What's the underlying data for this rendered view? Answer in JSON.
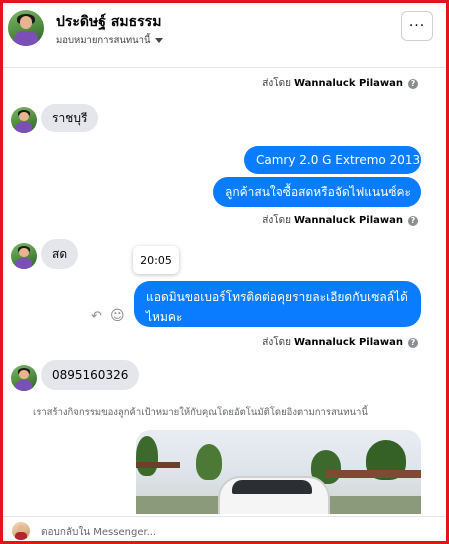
{
  "header": {
    "name": "ประดิษฐ์ สมธรรม",
    "subtitle": "มอบหมายการสนทนานี้",
    "more_label": "···"
  },
  "messages": {
    "sent_by_prefix": "ส่งโดย",
    "sent_by_name": "Wannaluck Pilawan",
    "incoming_1": "ราชบุรี",
    "outgoing_1": "Camry 2.0 G Extremo   2013",
    "outgoing_2": "ลูกค้าสนใจซื้อสดหรือจัดไฟแนนซ์คะ",
    "incoming_2": "สด",
    "tooltip_time": "20:05",
    "outgoing_3": "แอดมินขอเบอร์โทรติดต่อคุยรายละเอียดกับเซลล์ได้ไหมคะ",
    "incoming_3": "0895160326",
    "system_note": "เราสร้างกิจกรรมของลูกค้าเป้าหมายให้กับคุณโดยอัตโนมัติโดยอิงตามการสนทนานี้"
  },
  "footer": {
    "reply_placeholder": "ตอบกลับใน Messenger..."
  },
  "icons": {
    "reply": "reply-icon",
    "emoji": "emoji-icon",
    "info": "info-icon",
    "more": "more-icon"
  },
  "colors": {
    "outgoing_bubble": "#0a7cff",
    "incoming_bubble": "#e4e6eb",
    "frame": "#e4141b"
  }
}
